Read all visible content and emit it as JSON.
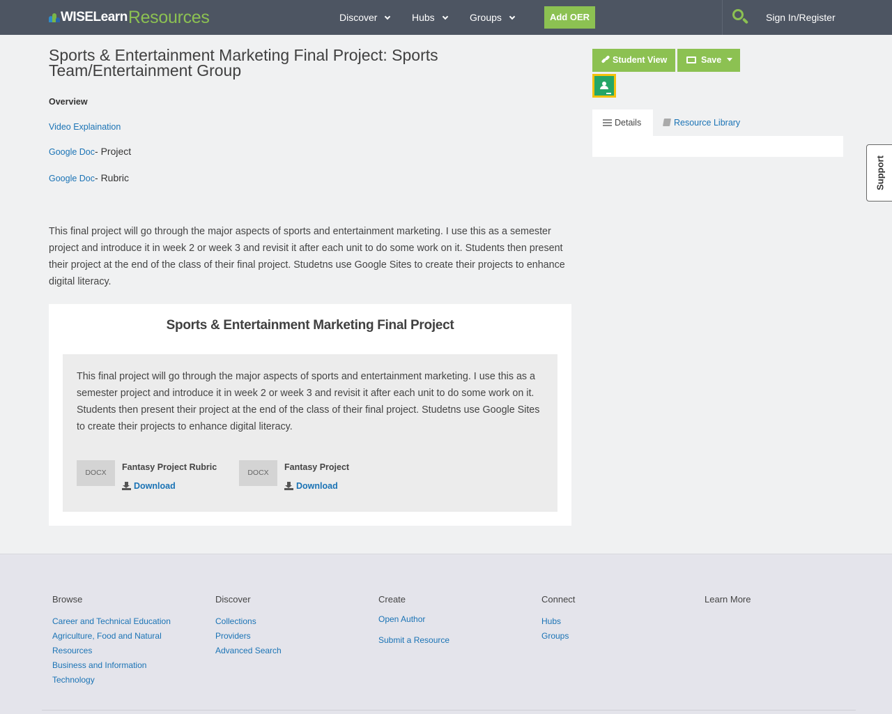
{
  "header": {
    "logo_primary": "WISELearn",
    "logo_secondary": "Resources",
    "nav": [
      {
        "label": "Discover"
      },
      {
        "label": "Hubs"
      },
      {
        "label": "Groups"
      }
    ],
    "add_oer_label": "Add OER",
    "signin_label": "Sign In/Register"
  },
  "main": {
    "title": "Sports & Entertainment Marketing Final Project: Sports Team/Entertainment Group",
    "overview_label": "Overview",
    "links": [
      {
        "link": "Video Explaination",
        "suffix": ""
      },
      {
        "link": "Google Doc",
        "suffix": "- Project"
      },
      {
        "link": "Google Doc",
        "suffix": "- Rubric"
      }
    ],
    "description": "This final project will go through the major aspects of sports and entertainment marketing.  I use this as a semester project and introduce it in week 2 or week 3 and revisit it after each unit to do some work on it.  Students then present their project at the end of the class of their final project.  Studetns use Google Sites to create their projects to enhance digital literacy.",
    "card": {
      "title": "Sports & Entertainment Marketing Final Project",
      "description": "This final project will go through the major aspects of sports and entertainment marketing.  I use this as a semester project and introduce it in week 2 or week 3 and revisit it after each unit to do some work on it.  Students then present their project at the end of the class of their final project.  Studetns use Google Sites to create their projects to enhance digital literacy.",
      "files": [
        {
          "type": "DOCX",
          "name": "Fantasy Project Rubric",
          "download_label": "Download"
        },
        {
          "type": "DOCX",
          "name": "Fantasy Project",
          "download_label": "Download"
        }
      ]
    }
  },
  "sidebar": {
    "student_view_label": "Student View",
    "save_label": "Save",
    "tabs": [
      {
        "label": "Details",
        "icon": "list-icon",
        "active": true
      },
      {
        "label": "Resource Library",
        "icon": "book-icon",
        "active": false
      }
    ],
    "support_label": "Support"
  },
  "footer": {
    "columns": [
      {
        "heading": "Browse",
        "links": [
          "Career and Technical Education",
          "Agriculture, Food and Natural Resources",
          "Business and Information Technology"
        ]
      },
      {
        "heading": "Discover",
        "links": [
          "Collections",
          "Providers",
          "Advanced Search"
        ]
      },
      {
        "heading": "Create",
        "links": [
          "Open Author",
          "Submit a Resource"
        ]
      },
      {
        "heading": "Connect",
        "links": [
          "Hubs",
          "Groups"
        ]
      },
      {
        "heading": "Learn More",
        "links": []
      }
    ]
  },
  "colors": {
    "header_bg": "#4d5562",
    "accent_green": "#8cc152",
    "link_blue": "#1a73b5",
    "page_bg": "#f0f1f2",
    "footer_bg": "#e4e4eb"
  }
}
